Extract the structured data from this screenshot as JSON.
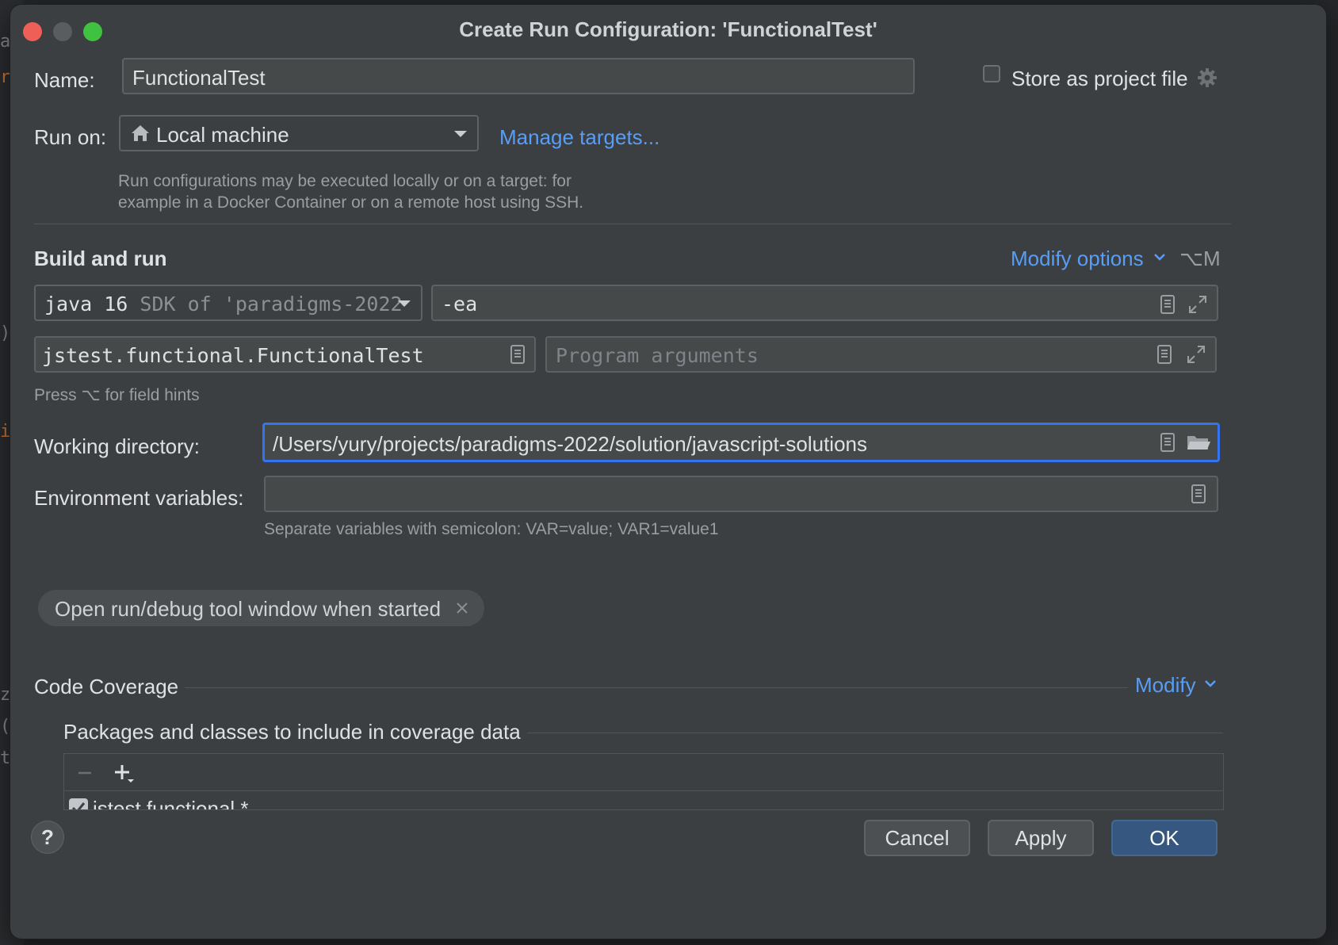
{
  "dialog": {
    "title": "Create Run Configuration: 'FunctionalTest'"
  },
  "name_row": {
    "label": "Name:",
    "value": "FunctionalTest",
    "store_label": "Store as project file",
    "store_checked": false
  },
  "run_on": {
    "label": "Run on:",
    "value": "Local machine",
    "manage_link": "Manage targets...",
    "hint_line1": "Run configurations may be executed locally or on a target: for",
    "hint_line2": "example in a Docker Container or on a remote host using SSH."
  },
  "build_run": {
    "heading": "Build and run",
    "modify_options": "Modify options",
    "modify_shortcut": "⌥M",
    "jdk_main": "java 16",
    "jdk_detail": "SDK of 'paradigms-2022",
    "vm_options": "-ea",
    "main_class": "jstest.functional.FunctionalTest",
    "program_args_placeholder": "Program arguments",
    "field_hint": "Press ⌥ for field hints"
  },
  "working_dir": {
    "label": "Working directory:",
    "value": "/Users/yury/projects/paradigms-2022/solution/javascript-solutions"
  },
  "env_vars": {
    "label": "Environment variables:",
    "value": "",
    "hint": "Separate variables with semicolon: VAR=value; VAR1=value1"
  },
  "chip": {
    "label": "Open run/debug tool window when started"
  },
  "coverage": {
    "heading": "Code Coverage",
    "modify": "Modify",
    "packages_heading": "Packages and classes to include in coverage data",
    "items": [
      {
        "label": "jstest.functional.*",
        "checked": true
      }
    ]
  },
  "footer": {
    "help": "?",
    "cancel": "Cancel",
    "apply": "Apply",
    "ok": "OK"
  },
  "colors": {
    "accent_link": "#589df6",
    "primary_button": "#365880",
    "focus_border": "#3574f0"
  }
}
